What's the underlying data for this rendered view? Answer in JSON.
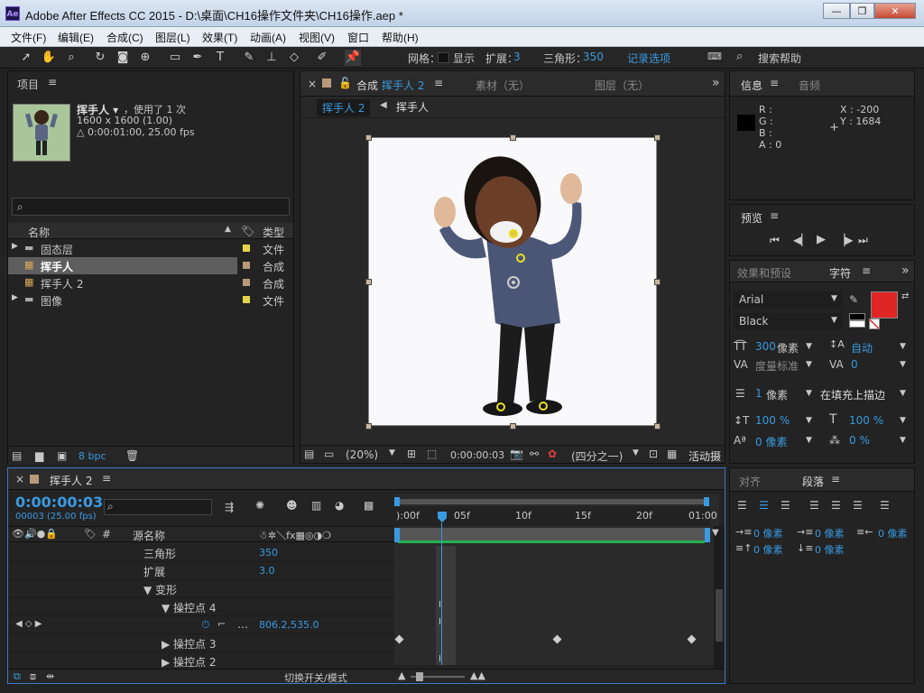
{
  "window": {
    "title": "Adobe After Effects CC 2015 - D:\\桌面\\CH16操作文件夹\\CH16操作.aep *",
    "logo": "Ae",
    "min": "—",
    "max": "❐",
    "close": "✕"
  },
  "menu": [
    "文件(F)",
    "编辑(E)",
    "合成(C)",
    "图层(L)",
    "效果(T)",
    "动画(A)",
    "视图(V)",
    "窗口",
    "帮助(H)"
  ],
  "toolbar": {
    "grid_label": "网格：",
    "show_label": "显示",
    "expand_label": "扩展：",
    "expand_value": "3",
    "triangle_label": "三角形：",
    "triangle_value": "350",
    "record_options": "记录选项",
    "search_help": "搜索帮助"
  },
  "project": {
    "panel_title": "项目",
    "comp_name": "挥手人 ▾",
    "used": "，使用了 1 次",
    "size": "1600 x 1600 (1.00)",
    "duration": "△ 0:00:01:00, 25.00 fps",
    "search_placeholder": "",
    "col_name": "名称",
    "col_type": "类型",
    "items": [
      {
        "name": "固态层",
        "type": "文件",
        "color": "#e5d44a",
        "icon": "folder-icon",
        "expander": "▶"
      },
      {
        "name": "挥手人",
        "type": "合成",
        "color": "#b89a7a",
        "icon": "composition-icon",
        "expander": ""
      },
      {
        "name": "挥手人 2",
        "type": "合成",
        "color": "#b89a7a",
        "icon": "composition-icon",
        "expander": ""
      },
      {
        "name": "图像",
        "type": "文件",
        "color": "#e5d44a",
        "icon": "folder-icon",
        "expander": "▶"
      }
    ],
    "bpc": "8 bpc"
  },
  "composition": {
    "tab_prefix": "合成",
    "tab_name": "挥手人 2",
    "footage_tab": "素材（无）",
    "layer_tab": "图层（无）",
    "crumb_active": "挥手人 2",
    "crumb_parent": "挥手人",
    "zoom": "(20%)",
    "timecode": "0:00:00:03",
    "resolution": "(四分之一)",
    "active_camera": "活动摄"
  },
  "info": {
    "tab": "信息",
    "audio_tab": "音频",
    "r": "R :",
    "g": "G :",
    "b": "B :",
    "a": "A : 0",
    "x": "X : -200",
    "y": "Y : 1684"
  },
  "preview": {
    "tab": "预览"
  },
  "character": {
    "effects_tab": "效果和预设",
    "tab": "字符",
    "font": "Arial",
    "style": "Black",
    "size_value": "300",
    "size_unit": "像素",
    "leading": "自动",
    "kerning": "度量标准",
    "tracking": "0",
    "stroke_value": "1",
    "stroke_unit": "像素",
    "stroke_mode": "在填充上描边",
    "vscale": "100 %",
    "hscale": "100 %",
    "baseline": "0 像素",
    "tsume": "0 %"
  },
  "paragraph": {
    "align_tab": "对齐",
    "tab": "段落",
    "indent_left": "0 像素",
    "indent_first": "0 像素",
    "indent_right": "0 像素",
    "space_before": "0 像素",
    "space_after": "0 像素"
  },
  "timeline": {
    "comp_name": "挥手人 2",
    "timecode": "0:00:00:03",
    "frame_info": "00003 (25.00 fps)",
    "source_name": "源名称",
    "hash": "#",
    "ruler": [
      "):00f",
      "05f",
      "10f",
      "15f",
      "20f",
      "01:00"
    ],
    "rows": [
      {
        "label": "三角形",
        "value": "350",
        "indent": 0
      },
      {
        "label": "扩展",
        "value": "3.0",
        "indent": 0
      },
      {
        "label": "▼ 变形",
        "value": "",
        "indent": 0
      },
      {
        "label": "▼ 操控点 4",
        "value": "",
        "indent": 1
      },
      {
        "label": "",
        "value": "806.2,535.0",
        "indent": 2
      },
      {
        "label": "▶ 操控点 3",
        "value": "",
        "indent": 1
      },
      {
        "label": "▶ 操控点 2",
        "value": "",
        "indent": 1
      }
    ],
    "switch_mode": "切换开关/模式"
  }
}
